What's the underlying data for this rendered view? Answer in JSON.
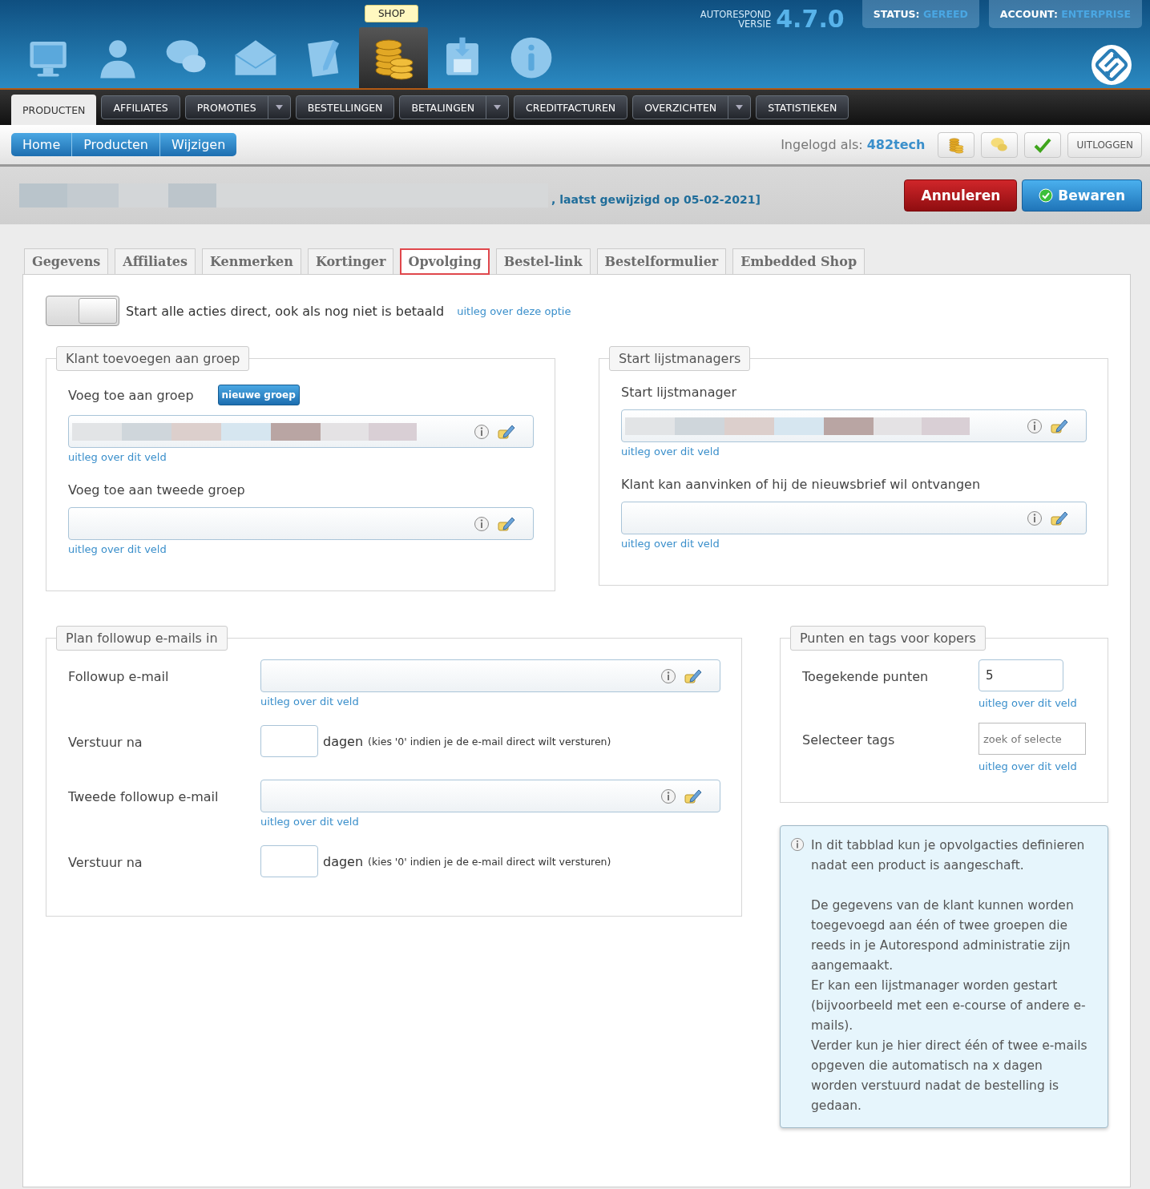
{
  "header": {
    "app_icons": [
      {
        "kind": "monitor",
        "selected": false
      },
      {
        "kind": "person",
        "selected": false
      },
      {
        "kind": "chat",
        "selected": false
      },
      {
        "kind": "mail",
        "selected": false
      },
      {
        "kind": "document",
        "selected": false
      },
      {
        "kind": "coins",
        "selected": true,
        "tooltip": "SHOP"
      },
      {
        "kind": "save",
        "selected": false
      },
      {
        "kind": "info",
        "selected": false
      }
    ],
    "version": {
      "line_1": "AUTORESPOND",
      "line_2": "VERSIE",
      "number": "4.7.0"
    },
    "status": {
      "label": "STATUS:",
      "value": "GEREED"
    },
    "account": {
      "label": "ACCOUNT:",
      "value": "ENTERPRISE"
    }
  },
  "nav": [
    {
      "label": "PRODUCTEN",
      "selected": true,
      "dropdown": false
    },
    {
      "label": "AFFILIATES",
      "selected": false,
      "dropdown": false
    },
    {
      "label": "PROMOTIES",
      "selected": false,
      "dropdown": true
    },
    {
      "label": "BESTELLINGEN",
      "selected": false,
      "dropdown": false
    },
    {
      "label": "BETALINGEN",
      "selected": false,
      "dropdown": true
    },
    {
      "label": "CREDITFACTUREN",
      "selected": false,
      "dropdown": false
    },
    {
      "label": "OVERZICHTEN",
      "selected": false,
      "dropdown": true
    },
    {
      "label": "STATISTIEKEN",
      "selected": false,
      "dropdown": false
    }
  ],
  "breadcrumb": [
    "Home",
    "Producten",
    "Wijzigen"
  ],
  "user": {
    "label": "Ingelogd als:",
    "name": "482tech",
    "tool_buttons": [
      {
        "kind": "coins"
      },
      {
        "kind": "chat"
      },
      {
        "kind": "check"
      }
    ],
    "logout": "UITLOGGEN"
  },
  "title": {
    "name_obscured": true,
    "suffix": ", laatst gewijzigd op 05-02-2021]",
    "cancel": "Annuleren",
    "save": "Bewaren"
  },
  "tabs": [
    {
      "label": "Gegevens",
      "selected": false,
      "highlighted": false
    },
    {
      "label": "Affiliates",
      "selected": false,
      "highlighted": false
    },
    {
      "label": "Kenmerken",
      "selected": false,
      "highlighted": false
    },
    {
      "label": "Kortinger",
      "selected": false,
      "highlighted": false
    },
    {
      "label": "Opvolging",
      "selected": true,
      "highlighted": true
    },
    {
      "label": "Bestel-link",
      "selected": false,
      "highlighted": false
    },
    {
      "label": "Bestelformulier",
      "selected": false,
      "highlighted": false
    },
    {
      "label": "Embedded Shop",
      "selected": false,
      "highlighted": false
    }
  ],
  "toggle": {
    "on": false,
    "label": "Start alle acties direct, ook als nog niet is betaald",
    "help": "uitleg over deze optie"
  },
  "group_section": {
    "legend": "Klant toevoegen aan groep",
    "new_group": "nieuwe groep",
    "fields": [
      {
        "label": "Voeg toe aan groep",
        "value_obscured": true,
        "help": "uitleg over dit veld"
      },
      {
        "label": "Voeg toe aan tweede groep",
        "value_obscured": false,
        "help": "uitleg over dit veld"
      }
    ]
  },
  "list_section": {
    "legend": "Start lijstmanagers",
    "fields": [
      {
        "label": "Start lijstmanager",
        "value_obscured": true,
        "help": "uitleg over dit veld"
      },
      {
        "label": "Klant kan aanvinken of hij de nieuwsbrief wil ontvangen",
        "value_obscured": false,
        "help": "uitleg over dit veld"
      }
    ]
  },
  "followup_section": {
    "legend": "Plan followup e-mails in",
    "rows": [
      {
        "kind": "select",
        "label": "Followup e-mail",
        "help": "uitleg over dit veld"
      },
      {
        "kind": "days",
        "label": "Verstuur na",
        "unit": "dagen",
        "note": "(kies '0' indien je de e-mail direct wilt versturen)"
      },
      {
        "kind": "select",
        "label": "Tweede followup e-mail",
        "help": "uitleg over dit veld"
      },
      {
        "kind": "days",
        "label": "Verstuur na",
        "unit": "dagen",
        "note": "(kies '0' indien je de e-mail direct wilt versturen)"
      }
    ]
  },
  "points_section": {
    "legend": "Punten en tags voor kopers",
    "rows": [
      {
        "kind": "value",
        "label": "Toegekende punten",
        "value": "5",
        "help": "uitleg over dit veld"
      },
      {
        "kind": "search",
        "label": "Selecteer tags",
        "placeholder": "zoek of selecte",
        "help": "uitleg over dit veld"
      }
    ]
  },
  "info_box": {
    "paragraphs": [
      "In dit tabblad kun je opvolgacties definieren nadat een product is aangeschaft.",
      "De gegevens van de klant kunnen worden toegevoegd aan één of twee groepen die reeds in je Autorespond administratie zijn aangemaakt.",
      "Er kan een lijstmanager worden gestart (bijvoorbeeld met een e-course of andere e-mails).",
      "Verder kun je hier direct één of twee e-mails opgeven die automatisch na x dagen worden verstuurd nadat de bestelling is gedaan."
    ]
  }
}
